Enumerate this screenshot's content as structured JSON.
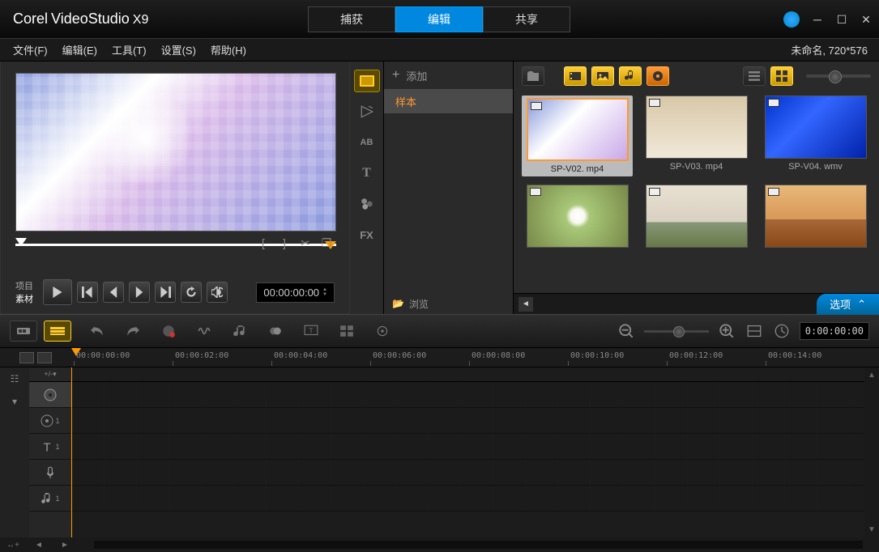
{
  "app": {
    "brand": "Corel",
    "name": "VideoStudio",
    "ver": "X9"
  },
  "tabs": {
    "capture": "捕获",
    "edit": "编辑",
    "share": "共享"
  },
  "menu": {
    "file": "文件(F)",
    "edit": "编辑(E)",
    "tools": "工具(T)",
    "settings": "设置(S)",
    "help": "帮助(H)"
  },
  "project_info": "未命名, 720*576",
  "preview": {
    "mode_project": "项目",
    "mode_clip": "素材",
    "tc": "00:00:00:00"
  },
  "library": {
    "add": "添加",
    "sample": "样本",
    "browse": "浏览",
    "options": "选项",
    "clips": [
      {
        "name": "SP-V02. mp4",
        "cls": "t1",
        "sel": true
      },
      {
        "name": "SP-V03. mp4",
        "cls": "t2",
        "sel": false
      },
      {
        "name": "SP-V04. wmv",
        "cls": "t3",
        "sel": false
      },
      {
        "name": "",
        "cls": "t4",
        "sel": false
      },
      {
        "name": "",
        "cls": "t5",
        "sel": false
      },
      {
        "name": "",
        "cls": "t6",
        "sel": false
      }
    ]
  },
  "timeline": {
    "tc": "0:00:00:00",
    "ruler": [
      "00:00:00:00",
      "00:00:02:00",
      "00:00:04:00",
      "00:00:06:00",
      "00:00:08:00",
      "00:00:10:00",
      "00:00:12:00",
      "00:00:14:00"
    ],
    "pm": "+/-▾"
  }
}
